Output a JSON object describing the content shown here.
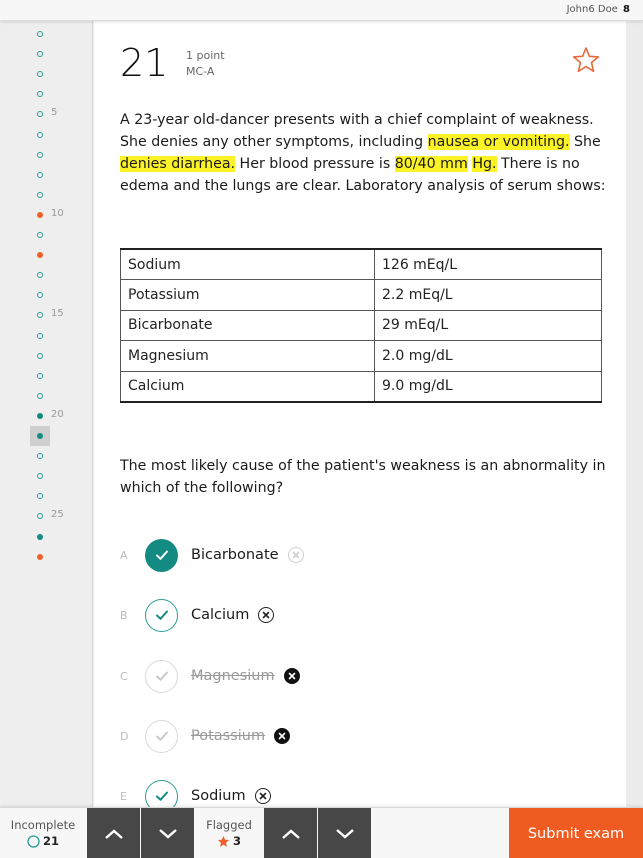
{
  "header": {
    "user_name": "John6 Doe",
    "user_badge": "8"
  },
  "sidebar": {
    "items": [
      {
        "n": 1,
        "state": "empty"
      },
      {
        "n": 2,
        "state": "empty"
      },
      {
        "n": 3,
        "state": "empty"
      },
      {
        "n": 4,
        "state": "empty"
      },
      {
        "n": 5,
        "state": "empty",
        "label": "5"
      },
      {
        "n": 6,
        "state": "empty"
      },
      {
        "n": 7,
        "state": "empty"
      },
      {
        "n": 8,
        "state": "empty"
      },
      {
        "n": 9,
        "state": "empty"
      },
      {
        "n": 10,
        "state": "flagged",
        "label": "10"
      },
      {
        "n": 11,
        "state": "empty"
      },
      {
        "n": 12,
        "state": "flagged"
      },
      {
        "n": 13,
        "state": "empty"
      },
      {
        "n": 14,
        "state": "empty"
      },
      {
        "n": 15,
        "state": "empty",
        "label": "15"
      },
      {
        "n": 16,
        "state": "empty"
      },
      {
        "n": 17,
        "state": "empty"
      },
      {
        "n": 18,
        "state": "empty"
      },
      {
        "n": 19,
        "state": "empty"
      },
      {
        "n": 20,
        "state": "answered",
        "label": "20"
      },
      {
        "n": 21,
        "state": "answered",
        "current": true
      },
      {
        "n": 22,
        "state": "empty"
      },
      {
        "n": 23,
        "state": "empty"
      },
      {
        "n": 24,
        "state": "empty"
      },
      {
        "n": 25,
        "state": "empty",
        "label": "25"
      },
      {
        "n": 26,
        "state": "answered"
      },
      {
        "n": 27,
        "state": "flagged"
      }
    ]
  },
  "question": {
    "number": "21",
    "points": "1 point",
    "type": "MC-A",
    "flag_icon": "star-outline-icon",
    "stem": {
      "p1": "A 23-year old-dancer presents with a chief complaint of weakness. She denies any other symptoms, including ",
      "h1": "nausea or vomiting.",
      "p2": " She ",
      "h2": "denies diarrhea.",
      "p3": " Her blood pressure is ",
      "h3": "80/40 mm",
      "p4": " ",
      "h4": "Hg.",
      "p5": " There is no edema and the lungs are clear. Laboratory analysis of serum shows:"
    },
    "labs": [
      {
        "name": "Sodium",
        "value": "126 mEq/L"
      },
      {
        "name": "Potassium",
        "value": "2.2 mEq/L"
      },
      {
        "name": "Bicarbonate",
        "value": "29 mEq/L"
      },
      {
        "name": "Magnesium",
        "value": "2.0 mg/dL"
      },
      {
        "name": "Calcium",
        "value": "9.0 mg/dL"
      }
    ],
    "prompt": "The most likely cause of the patient's weakness is an abnormality in which of the following?",
    "options": [
      {
        "letter": "A",
        "label": "Bicarbonate",
        "state": "selected"
      },
      {
        "letter": "B",
        "label": "Calcium",
        "state": "ring"
      },
      {
        "letter": "C",
        "label": "Magnesium",
        "state": "struck"
      },
      {
        "letter": "D",
        "label": "Potassium",
        "state": "struck"
      },
      {
        "letter": "E",
        "label": "Sodium",
        "state": "ring"
      }
    ]
  },
  "footer": {
    "incomplete_label": "Incomplete",
    "incomplete_count": "21",
    "flagged_label": "Flagged",
    "flagged_count": "3",
    "submit_label": "Submit exam"
  },
  "colors": {
    "accent_teal": "#138a82",
    "accent_orange": "#f05b22",
    "highlight": "#fbf326",
    "nav_button": "#474747"
  }
}
